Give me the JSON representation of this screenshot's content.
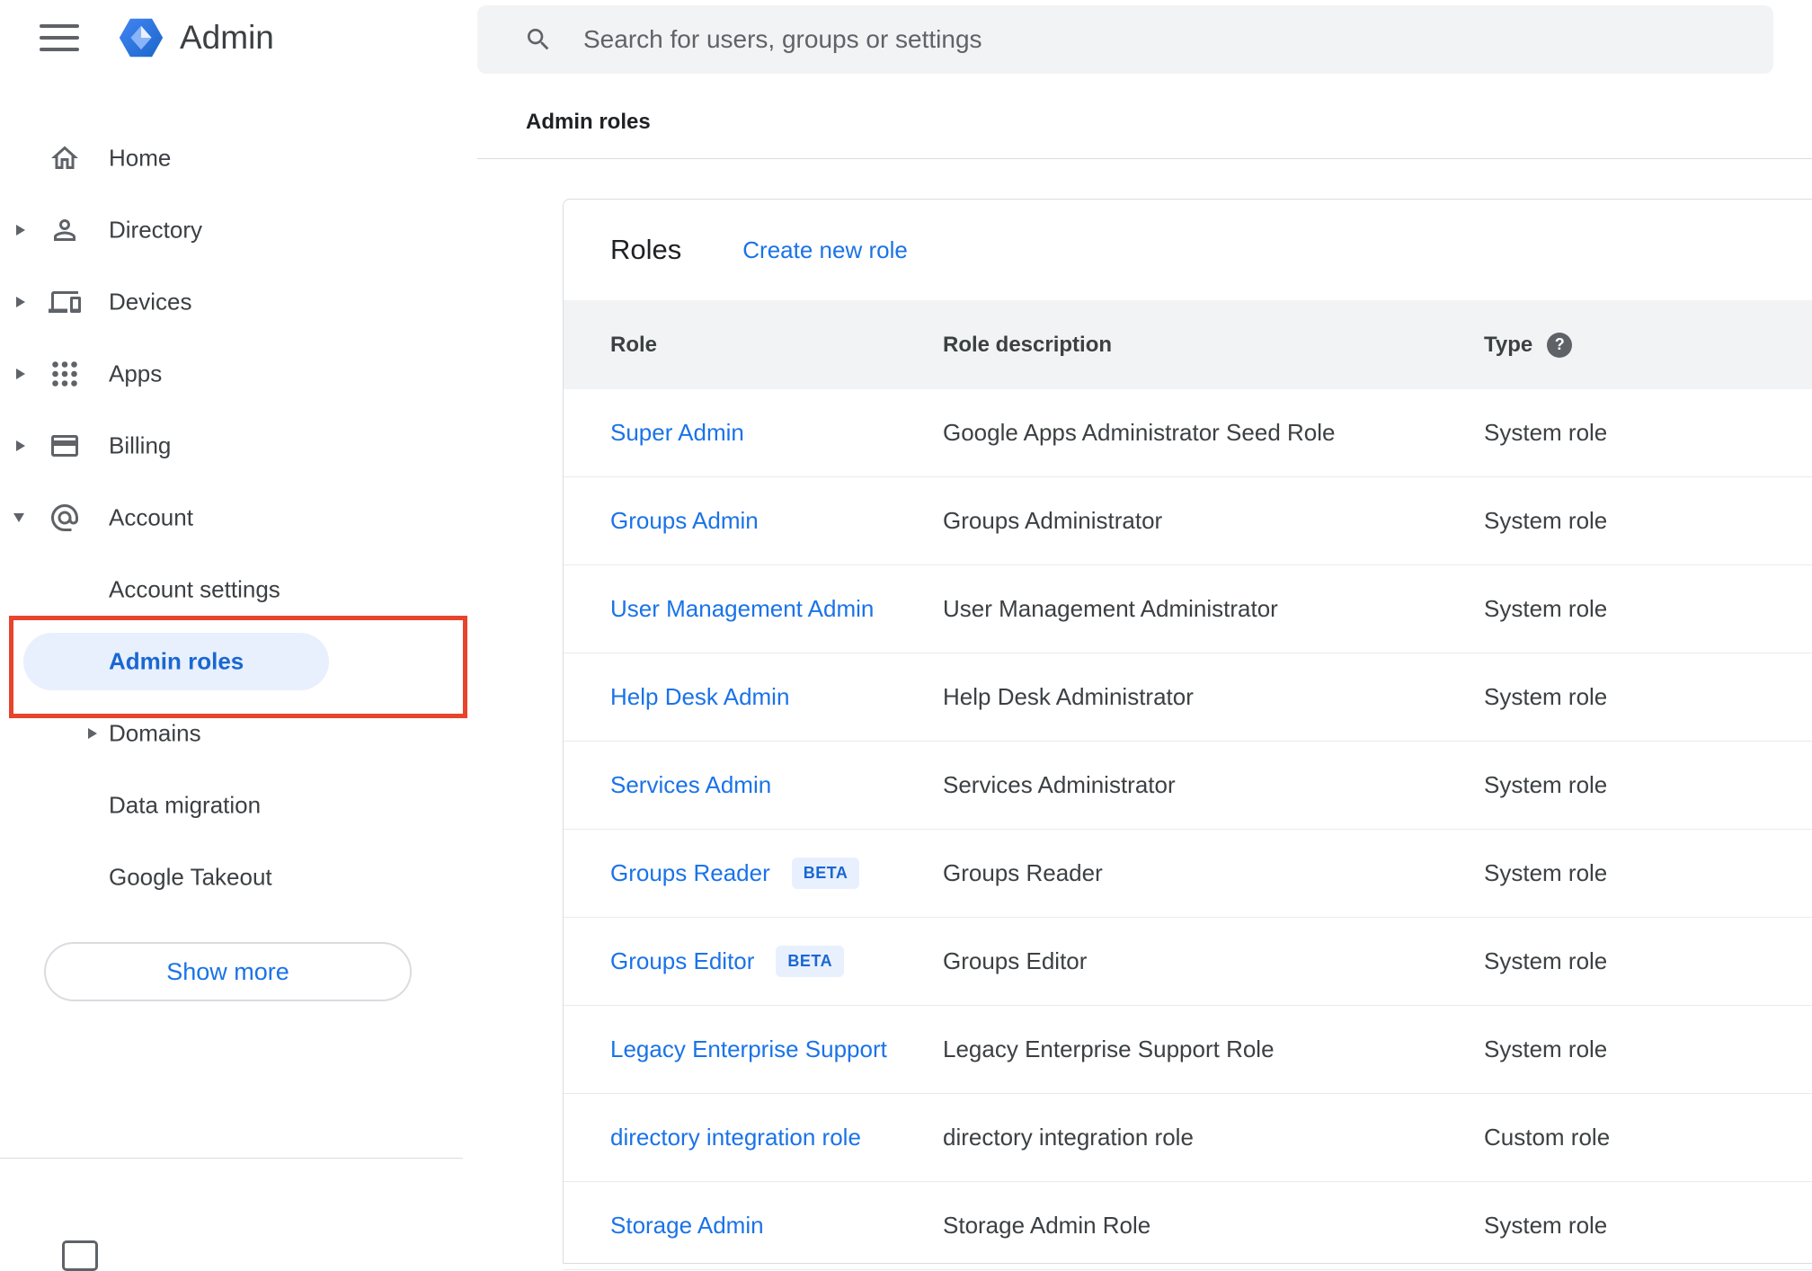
{
  "app": {
    "name": "Admin"
  },
  "search": {
    "placeholder": "Search for users, groups or settings"
  },
  "breadcrumb": "Admin roles",
  "sidebar": {
    "items": [
      {
        "label": "Home"
      },
      {
        "label": "Directory"
      },
      {
        "label": "Devices"
      },
      {
        "label": "Apps"
      },
      {
        "label": "Billing"
      },
      {
        "label": "Account"
      }
    ],
    "account_children": [
      {
        "label": "Account settings"
      },
      {
        "label": "Admin roles"
      },
      {
        "label": "Domains"
      },
      {
        "label": "Data migration"
      },
      {
        "label": "Google Takeout"
      }
    ],
    "show_more_label": "Show more"
  },
  "main": {
    "title": "Roles",
    "create_link": "Create new role",
    "table": {
      "headers": {
        "role": "Role",
        "description": "Role description",
        "type": "Type",
        "help": "?"
      },
      "rows": [
        {
          "role": "Super Admin",
          "description": "Google Apps Administrator Seed Role",
          "type": "System role"
        },
        {
          "role": "Groups Admin",
          "description": "Groups Administrator",
          "type": "System role"
        },
        {
          "role": "User Management Admin",
          "description": "User Management Administrator",
          "type": "System role"
        },
        {
          "role": "Help Desk Admin",
          "description": "Help Desk Administrator",
          "type": "System role"
        },
        {
          "role": "Services Admin",
          "description": "Services Administrator",
          "type": "System role"
        },
        {
          "role": "Groups Reader",
          "badge": "BETA",
          "description": "Groups Reader",
          "type": "System role"
        },
        {
          "role": "Groups Editor",
          "badge": "BETA",
          "description": "Groups Editor",
          "type": "System role"
        },
        {
          "role": "Legacy Enterprise Support",
          "description": "Legacy Enterprise Support Role",
          "type": "System role"
        },
        {
          "role": "directory integration role",
          "description": "directory integration role",
          "type": "Custom role"
        },
        {
          "role": "Storage Admin",
          "description": "Storage Admin Role",
          "type": "System role"
        }
      ]
    }
  },
  "icons": {
    "menu": "hamburger-menu-icon",
    "logo": "admin-hexagon-logo",
    "search": "search-icon",
    "home": "home-icon",
    "directory": "person-icon",
    "devices": "devices-icon",
    "apps": "apps-grid-icon",
    "billing": "credit-card-icon",
    "account": "at-sign-icon",
    "expand": "chevron-right-icon",
    "collapse": "chevron-down-icon",
    "type_help": "question-mark-help-icon"
  },
  "colors": {
    "accent_blue": "#1a73e8",
    "selected_text": "#1967d2",
    "selected_bg": "#e8f0fe",
    "badge_bg": "#e8f0fe",
    "badge_text": "#1967d2",
    "search_bg": "#f1f3f4",
    "table_header_bg": "#f1f3f4",
    "annotation_red": "#e8442c"
  }
}
